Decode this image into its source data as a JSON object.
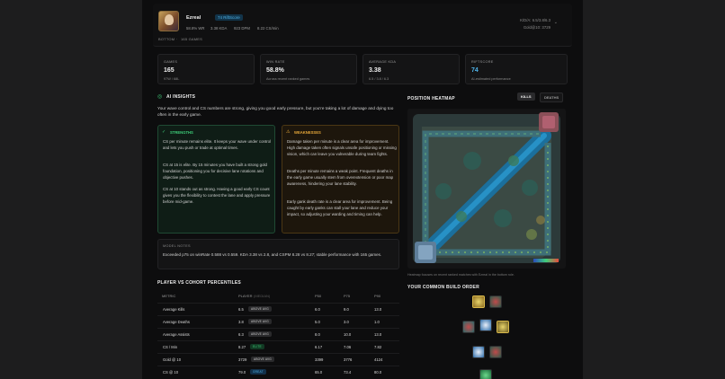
{
  "header": {
    "champion": "Ezreal",
    "riftscore_badge": "74 RiftScore",
    "meta": [
      "58.8% WR",
      "3.38 KDA",
      "923 DPM",
      "8.22 CS/min"
    ],
    "right_kda": "K/D/A: 6.5/3.8/6.3",
    "right_gold": "Gold@10: 3729",
    "breadcrumb_lane": "BOTTOM",
    "breadcrumb_sep": "·",
    "breadcrumb_games": "165 GAMES"
  },
  "stats": [
    {
      "label": "GAMES",
      "value": "165",
      "sub": "97W / 68L"
    },
    {
      "label": "WIN RATE",
      "value": "58.8%",
      "sub": "Across recent ranked games"
    },
    {
      "label": "AVERAGE KDA",
      "value": "3.38",
      "sub": "6.5 / 3.8 / 6.3"
    },
    {
      "label": "RIFTSCORE",
      "value": "74",
      "sub": "AI-estimated performance"
    }
  ],
  "insights": {
    "title": "AI INSIGHTS",
    "summary": "Your wave control and CS numbers are strong, giving you good early pressure, but you're taking a lot of damage and dying too often in the early game.",
    "strengths_title": "STRENGTHS",
    "strengths": [
      "CS per minute remains elite. It keeps your wave under control and lets you push or trade at optimal times.",
      "CS at 15 is elite. By 15 minutes you have built a strong gold foundation, positioning you for decisive lane rotations and objective pushes.",
      "CS at 10 stands out as strong. Having a good early CS count gives you the flexibility to contest the lane and apply pressure before mid-game."
    ],
    "weaknesses_title": "WEAKNESSES",
    "weaknesses": [
      "Damage taken per minute is a clear area for improvement. High damage taken often signals unsafe positioning or missing vision, which can leave you vulnerable during team fights.",
      "Deaths per minute remains a weak point. Frequent deaths in the early game usually stem from overextension or poor map awareness, hindering your lane stability.",
      "Early gank death rate is a clear area for improvement. Being caught by early ganks can stall your lane and reduce your impact, so adjusting your warding and timing can help."
    ],
    "notes_label": "MODEL NOTES",
    "notes": "Exceeded p75 on winRate 0.588 vs 0.559. KDA 3.38 vs 2.8, and CSPM 8.28 vs 8.27; stable performance with 165 games."
  },
  "heatmap": {
    "title": "POSITION HEATMAP",
    "tabs": [
      "KILLS",
      "DEATHS"
    ],
    "active_tab": "KILLS",
    "caption": "Heatmap focuses on recent ranked matches with Ezreal in the bottom role."
  },
  "build": {
    "title": "YOUR COMMON BUILD ORDER"
  },
  "percentiles": {
    "title": "PLAYER VS COHORT PERCENTILES",
    "columns": [
      "METRIC",
      "PLAYER",
      "(MEDIAN)",
      "P50",
      "P75",
      "P90"
    ],
    "rows": [
      {
        "metric": "Average Kills",
        "player": "6.5",
        "badge": "ABOVE AVG",
        "p50": "6.0",
        "p75": "9.0",
        "p90": "13.0"
      },
      {
        "metric": "Average Deaths",
        "player": "3.8",
        "badge": "ABOVE AVG",
        "p50": "5.0",
        "p75": "3.0",
        "p90": "1.0"
      },
      {
        "metric": "Average Assists",
        "player": "6.3",
        "badge": "ABOVE AVG",
        "p50": "8.0",
        "p75": "10.0",
        "p90": "13.0"
      },
      {
        "metric": "CS / Min",
        "player": "8.27",
        "badge": "ELITE",
        "p50": "6.17",
        "p75": "7.06",
        "p90": "7.82"
      },
      {
        "metric": "Gold @ 10",
        "player": "3729",
        "badge": "ABOVE AVG",
        "p50": "3399",
        "p75": "3776",
        "p90": "4124"
      },
      {
        "metric": "CS @ 10",
        "player": "79.0",
        "badge": "GREAT",
        "p50": "65.0",
        "p75": "73.4",
        "p90": "80.0"
      }
    ]
  },
  "colors": {
    "accent": "#4fb3e8",
    "strength": "#3ecf7a",
    "weakness": "#e8a93a",
    "elite": "#3ecf7a",
    "great": "#4fb3e8"
  }
}
